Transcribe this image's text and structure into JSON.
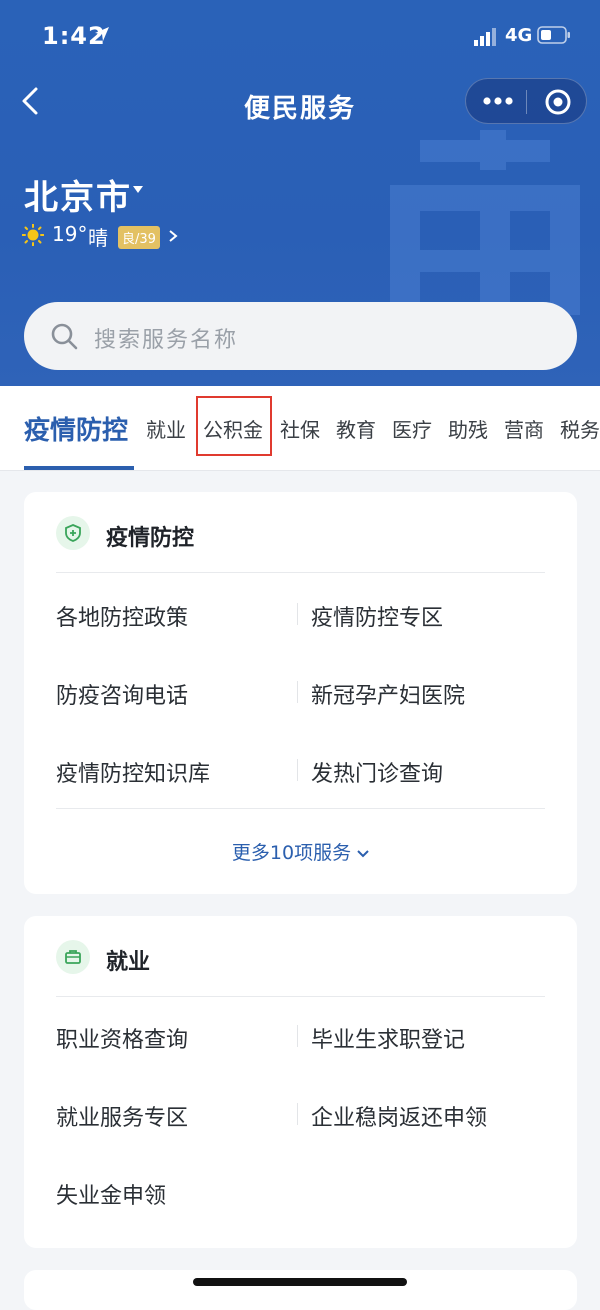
{
  "status_bar": {
    "time": "1:42",
    "network": "4G"
  },
  "nav": {
    "title": "便民服务"
  },
  "location": {
    "city": "北京市",
    "temperature": "19°",
    "condition": "晴",
    "aqi": "良/39"
  },
  "search": {
    "placeholder": "搜索服务名称"
  },
  "tabs": [
    {
      "label": "疫情防控",
      "active": true
    },
    {
      "label": "就业"
    },
    {
      "label": "公积金",
      "highlighted": true
    },
    {
      "label": "社保"
    },
    {
      "label": "教育"
    },
    {
      "label": "医疗"
    },
    {
      "label": "助残"
    },
    {
      "label": "营商"
    },
    {
      "label": "税务"
    }
  ],
  "sections": [
    {
      "title": "疫情防控",
      "items": [
        "各地防控政策",
        "疫情防控专区",
        "防疫咨询电话",
        "新冠孕产妇医院",
        "疫情防控知识库",
        "发热门诊查询"
      ],
      "more": "更多10项服务"
    },
    {
      "title": "就业",
      "items": [
        "职业资格查询",
        "毕业生求职登记",
        "就业服务专区",
        "企业稳岗返还申领",
        "失业金申领"
      ]
    }
  ],
  "colors": {
    "header_blue": "#2a62b8",
    "accent": "#2b5fae",
    "highlight_red": "#e03a2f",
    "aqi_badge": "#e3c163"
  },
  "icons": [
    "location-arrow-icon",
    "signal-icon",
    "battery-icon",
    "back-arrow-icon",
    "more-dots-icon",
    "target-icon",
    "caret-down-icon",
    "sun-icon",
    "chevron-right-icon",
    "search-icon",
    "shield-icon",
    "briefcase-icon",
    "chevron-down-icon"
  ]
}
